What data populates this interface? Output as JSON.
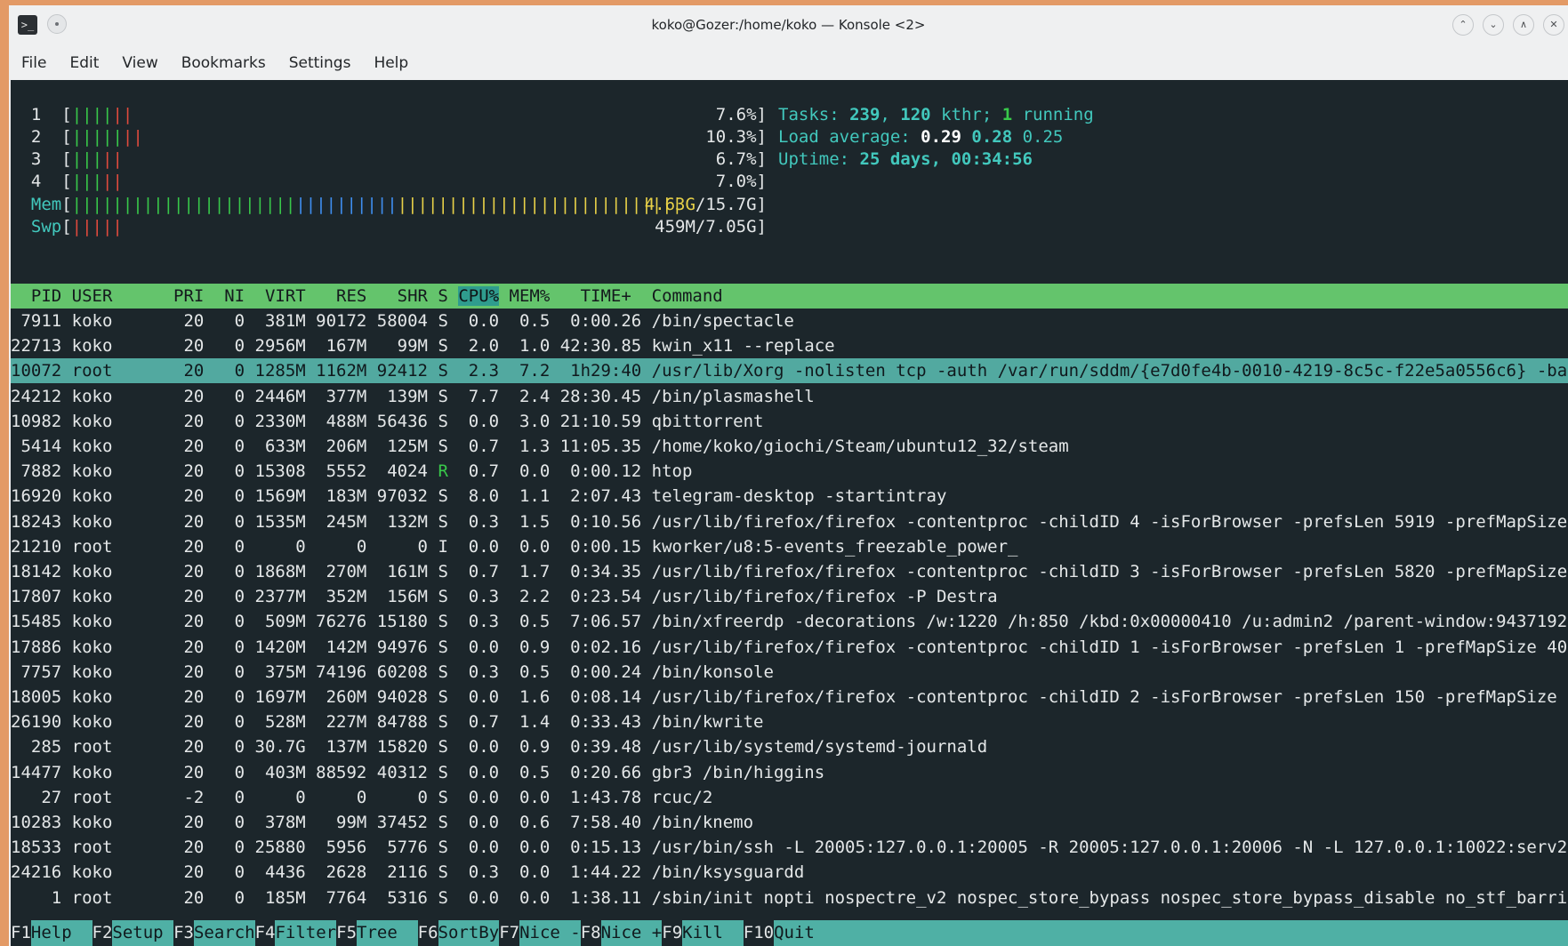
{
  "window": {
    "title": "koko@Gozer:/home/koko — Konsole <2>",
    "app_icon": "terminal-icon",
    "controls": [
      "keep-above-icon",
      "minimize-icon",
      "maximize-icon",
      "close-icon"
    ]
  },
  "menubar": {
    "items": [
      "File",
      "Edit",
      "View",
      "Bookmarks",
      "Settings",
      "Help"
    ]
  },
  "meters": {
    "cpus": [
      {
        "num": "1",
        "green": "||||",
        "red": "||",
        "value": "7.6%]"
      },
      {
        "num": "2",
        "green": "|||||",
        "red": "||",
        "value": "10.3%]"
      },
      {
        "num": "3",
        "green": "|||",
        "red": "||",
        "value": "6.7%]"
      },
      {
        "num": "4",
        "green": "|||",
        "red": "||",
        "value": "7.0%]"
      }
    ],
    "mem": {
      "label": "Mem",
      "green": "||||||||||||||||||||||",
      "blue": "||||||||||",
      "yellow": "||||||||||||||||||||||||||||",
      "value_used": "4.63G",
      "value_total": "/15.7G]"
    },
    "swp": {
      "label": "Swp",
      "red": "|||||",
      "value": "459M/7.05G]"
    }
  },
  "info": {
    "tasks_label": "Tasks: ",
    "tasks": "239",
    "comma1": ", ",
    "kthr": "120",
    "kthr_label": " kthr; ",
    "running": "1",
    "running_label": " running",
    "load_label": "Load average: ",
    "load1": "0.29",
    "load5": "0.28",
    "load15": "0.25",
    "uptime_label": "Uptime: ",
    "uptime": "25 days, 00:34:56"
  },
  "table": {
    "header_before": "  PID USER      PRI  NI  VIRT   RES   SHR S ",
    "header_sorted": "CPU%",
    "header_after": " MEM%   TIME+  Command",
    "selected_index": 2,
    "rows": [
      {
        "pre": " 7911 koko       20   0  381M 90172 58004 ",
        "s": "S",
        "post": "  0.0  0.5  0:00.26 /bin/spectacle"
      },
      {
        "pre": "22713 koko       20   0 2956M  167M   99M ",
        "s": "S",
        "post": "  2.0  1.0 42:30.85 kwin_x11 --replace"
      },
      {
        "pre": "10072 root       20   0 1285M 1162M 92412 ",
        "s": "S",
        "post": "  2.3  7.2  1h29:40 /usr/lib/Xorg -nolisten tcp -auth /var/run/sddm/{e7d0fe4b-0010-4219-8c5c-f22e5a0556c6} -ba"
      },
      {
        "pre": "24212 koko       20   0 2446M  377M  139M ",
        "s": "S",
        "post": "  7.7  2.4 28:30.45 /bin/plasmashell"
      },
      {
        "pre": "10982 koko       20   0 2330M  488M 56436 ",
        "s": "S",
        "post": "  0.0  3.0 21:10.59 qbittorrent"
      },
      {
        "pre": " 5414 koko       20   0  633M  206M  125M ",
        "s": "S",
        "post": "  0.7  1.3 11:05.35 /home/koko/giochi/Steam/ubuntu12_32/steam"
      },
      {
        "pre": " 7882 koko       20   0 15308  5552  4024 ",
        "s": "R",
        "post": "  0.7  0.0  0:00.12 htop"
      },
      {
        "pre": "16920 koko       20   0 1569M  183M 97032 ",
        "s": "S",
        "post": "  8.0  1.1  2:07.43 telegram-desktop -startintray"
      },
      {
        "pre": "18243 koko       20   0 1535M  245M  132M ",
        "s": "S",
        "post": "  0.3  1.5  0:10.56 /usr/lib/firefox/firefox -contentproc -childID 4 -isForBrowser -prefsLen 5919 -prefMapSize"
      },
      {
        "pre": "21210 root       20   0     0     0     0 ",
        "s": "I",
        "post": "  0.0  0.0  0:00.15 kworker/u8:5-events_freezable_power_"
      },
      {
        "pre": "18142 koko       20   0 1868M  270M  161M ",
        "s": "S",
        "post": "  0.7  1.7  0:34.35 /usr/lib/firefox/firefox -contentproc -childID 3 -isForBrowser -prefsLen 5820 -prefMapSize"
      },
      {
        "pre": "17807 koko       20   0 2377M  352M  156M ",
        "s": "S",
        "post": "  0.3  2.2  0:23.54 /usr/lib/firefox/firefox -P Destra"
      },
      {
        "pre": "15485 koko       20   0  509M 76276 15180 ",
        "s": "S",
        "post": "  0.3  0.5  7:06.57 /bin/xfreerdp -decorations /w:1220 /h:850 /kbd:0x00000410 /u:admin2 /parent-window:9437192"
      },
      {
        "pre": "17886 koko       20   0 1420M  142M 94976 ",
        "s": "S",
        "post": "  0.0  0.9  0:02.16 /usr/lib/firefox/firefox -contentproc -childID 1 -isForBrowser -prefsLen 1 -prefMapSize 40"
      },
      {
        "pre": " 7757 koko       20   0  375M 74196 60208 ",
        "s": "S",
        "post": "  0.3  0.5  0:00.24 /bin/konsole"
      },
      {
        "pre": "18005 koko       20   0 1697M  260M 94028 ",
        "s": "S",
        "post": "  0.0  1.6  0:08.14 /usr/lib/firefox/firefox -contentproc -childID 2 -isForBrowser -prefsLen 150 -prefMapSize"
      },
      {
        "pre": "26190 koko       20   0  528M  227M 84788 ",
        "s": "S",
        "post": "  0.7  1.4  0:33.43 /bin/kwrite"
      },
      {
        "pre": "  285 root       20   0 30.7G  137M 15820 ",
        "s": "S",
        "post": "  0.0  0.9  0:39.48 /usr/lib/systemd/systemd-journald"
      },
      {
        "pre": "14477 koko       20   0  403M 88592 40312 ",
        "s": "S",
        "post": "  0.0  0.5  0:20.66 gbr3 /bin/higgins"
      },
      {
        "pre": "   27 root       -2   0     0     0     0 ",
        "s": "S",
        "post": "  0.0  0.0  1:43.78 rcuc/2"
      },
      {
        "pre": "10283 koko       20   0  378M   99M 37452 ",
        "s": "S",
        "post": "  0.0  0.6  7:58.40 /bin/knemo"
      },
      {
        "pre": "18533 root       20   0 25880  5956  5776 ",
        "s": "S",
        "post": "  0.0  0.0  0:15.13 /usr/bin/ssh -L 20005:127.0.0.1:20005 -R 20005:127.0.0.1:20006 -N -L 127.0.0.1:10022:serv2"
      },
      {
        "pre": "24216 koko       20   0  4436  2628  2116 ",
        "s": "S",
        "post": "  0.3  0.0  1:44.22 /bin/ksysguardd"
      },
      {
        "pre": "    1 root       20   0  185M  7764  5316 ",
        "s": "S",
        "post": "  0.0  0.0  1:38.11 /sbin/init nopti nospectre_v2 nospec_store_bypass nospec_store_bypass_disable no_stf_barri"
      }
    ]
  },
  "fkeys": [
    {
      "num": "F1",
      "label": "Help  "
    },
    {
      "num": "F2",
      "label": "Setup "
    },
    {
      "num": "F3",
      "label": "Search"
    },
    {
      "num": "F4",
      "label": "Filter"
    },
    {
      "num": "F5",
      "label": "Tree  "
    },
    {
      "num": "F6",
      "label": "SortBy"
    },
    {
      "num": "F7",
      "label": "Nice -"
    },
    {
      "num": "F8",
      "label": "Nice +"
    },
    {
      "num": "F9",
      "label": "Kill  "
    },
    {
      "num": "F10",
      "label": "Quit"
    }
  ],
  "colors": {
    "terminal_bg": "#1c262b",
    "header_bg": "#64c46c",
    "selected_bg": "#52a9a0",
    "fkey_bg": "#4fb0a5"
  }
}
